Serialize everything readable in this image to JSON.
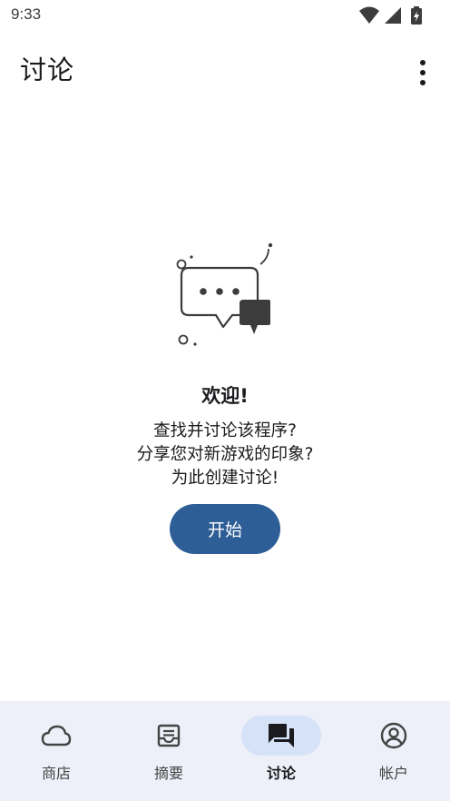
{
  "status_bar": {
    "time": "9:33",
    "icons": [
      "wifi-icon",
      "signal-icon",
      "battery-charging-icon"
    ]
  },
  "app_bar": {
    "title": "讨论",
    "overflow_icon": "more-vert-icon"
  },
  "empty_state": {
    "illustration": "chat-bubbles-illustration",
    "title": "欢迎!",
    "lines": [
      "查找并讨论该程序?",
      "分享您对新游戏的印象?",
      "为此创建讨论!"
    ],
    "button_label": "开始",
    "accent_color": "#2d5e96"
  },
  "bottom_nav": {
    "active_index": 2,
    "active_indicator_color": "#d6e2f7",
    "items": [
      {
        "label": "商店",
        "icon": "cloud-icon"
      },
      {
        "label": "摘要",
        "icon": "inbox-icon"
      },
      {
        "label": "讨论",
        "icon": "forum-icon"
      },
      {
        "label": "帐户",
        "icon": "account-circle-icon"
      }
    ]
  }
}
